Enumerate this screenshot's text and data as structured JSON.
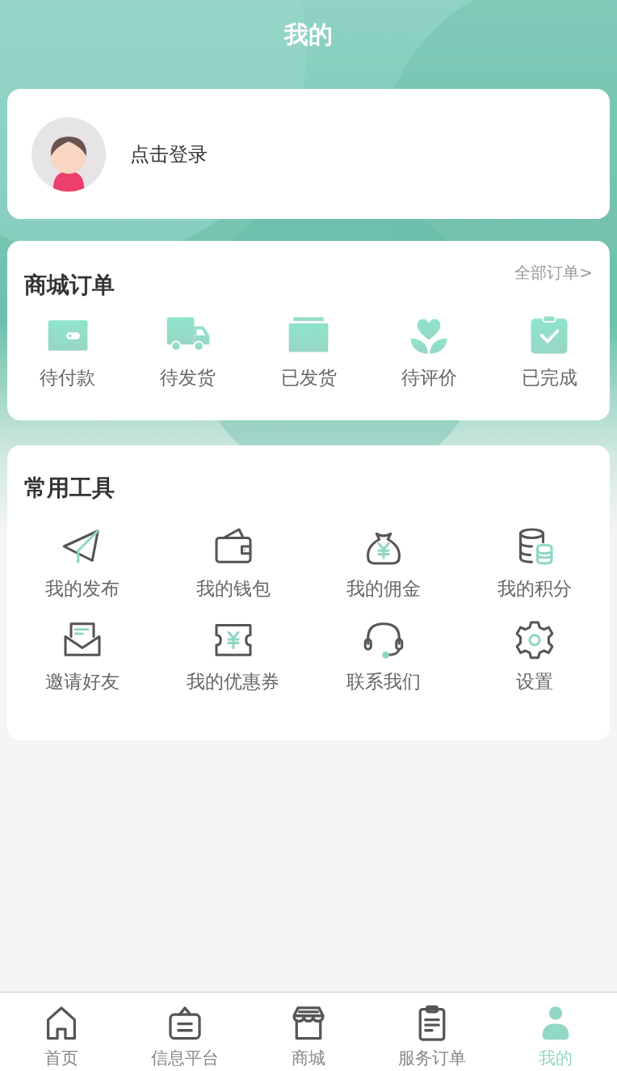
{
  "header": {
    "title": "我的"
  },
  "profile": {
    "login_label": "点击登录"
  },
  "mall_orders": {
    "title": "商城订单",
    "all_link": "全部订单>",
    "items": [
      {
        "label": "待付款"
      },
      {
        "label": "待发货"
      },
      {
        "label": "已发货"
      },
      {
        "label": "待评价"
      },
      {
        "label": "已完成"
      }
    ]
  },
  "tools": {
    "title": "常用工具",
    "items": [
      {
        "label": "我的发布"
      },
      {
        "label": "我的钱包"
      },
      {
        "label": "我的佣金"
      },
      {
        "label": "我的积分"
      },
      {
        "label": "邀请好友"
      },
      {
        "label": "我的优惠券"
      },
      {
        "label": "联系我们"
      },
      {
        "label": "设置"
      }
    ]
  },
  "tab_bar": [
    {
      "label": "首页",
      "selected": false
    },
    {
      "label": "信息平台",
      "selected": false
    },
    {
      "label": "商城",
      "selected": false
    },
    {
      "label": "服务订单",
      "selected": false
    },
    {
      "label": "我的",
      "selected": true
    }
  ]
}
